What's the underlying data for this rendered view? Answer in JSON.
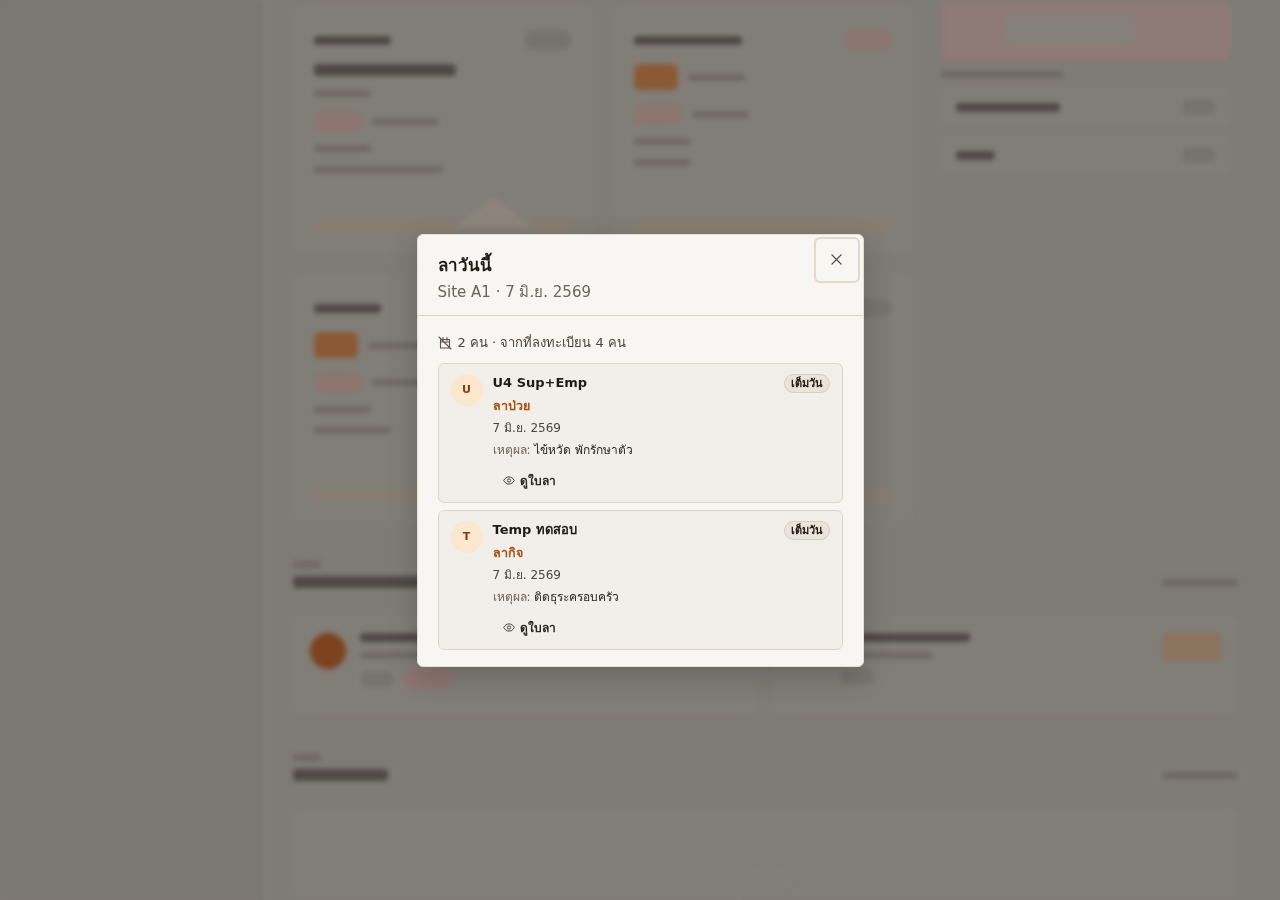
{
  "dialog": {
    "title": "ลาวันนี้",
    "subtitle": "Site A1 · 7 มิ.ย. 2569",
    "summary": "2 คน · จากที่ลงทะเบียน 4 คน",
    "leaves": [
      {
        "initial": "U",
        "name": "U4 Sup+Emp",
        "leave_type": "ลาป่วย",
        "date": "7 มิ.ย. 2569",
        "reason_label": "เหตุผล:",
        "reason": "ไข้หวัด พักรักษาตัว",
        "duration": "เต็มวัน",
        "view_label": "ดูใบลา"
      },
      {
        "initial": "T",
        "name": "Temp ทดสอบ",
        "leave_type": "ลากิจ",
        "date": "7 มิ.ย. 2569",
        "reason_label": "เหตุผล:",
        "reason": "ติดธุระครอบครัว",
        "duration": "เต็มวัน",
        "view_label": "ดูใบลา"
      }
    ]
  }
}
